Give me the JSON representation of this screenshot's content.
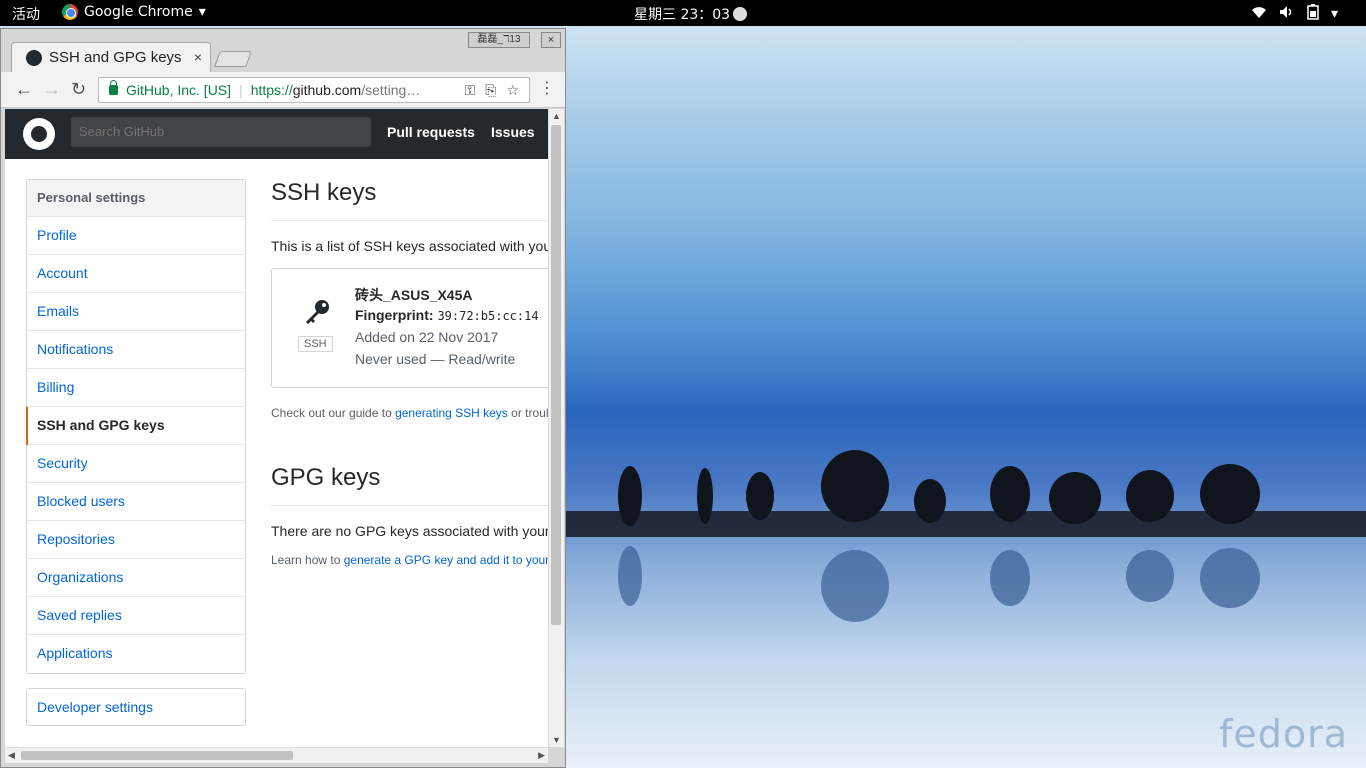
{
  "topbar": {
    "activities": "活动",
    "app_name": "Google Chrome",
    "app_menu_icon": "chevron-down-icon",
    "clock": "星期三 23：03"
  },
  "window": {
    "tab_title": "SSH and GPG keys",
    "tab_close": "×",
    "profile_badge": "磊磊_ℸ13",
    "close": "×"
  },
  "omnibox": {
    "ev_label": "GitHub, Inc. [US]",
    "url_scheme": "https://",
    "url_domain": "github.com",
    "url_path": "/setting…"
  },
  "github": {
    "search_placeholder": "Search GitHub",
    "nav": [
      "Pull requests",
      "Issues"
    ],
    "menu_heading": "Personal settings",
    "menu": [
      "Profile",
      "Account",
      "Emails",
      "Notifications",
      "Billing",
      "SSH and GPG keys",
      "Security",
      "Blocked users",
      "Repositories",
      "Organizations",
      "Saved replies",
      "Applications"
    ],
    "selected_menu": "SSH and GPG keys",
    "developer_settings": "Developer settings",
    "ssh_heading": "SSH keys",
    "ssh_description": "This is a list of SSH keys associated with you",
    "key": {
      "title": "砖头_ASUS_X45A",
      "fingerprint_label": "Fingerprint:",
      "fingerprint": "39:72:b5:cc:14",
      "added": "Added on 22 Nov 2017",
      "usage": "Never used — Read/write",
      "badge": "SSH"
    },
    "ssh_guide_prefix": "Check out our guide to ",
    "ssh_guide_link": "generating SSH keys",
    "ssh_guide_suffix": " or troul",
    "gpg_heading": "GPG keys",
    "gpg_description": "There are no GPG keys associated with your",
    "gpg_learn_prefix": "Learn how to ",
    "gpg_learn_link": "generate a GPG key and add it to your"
  },
  "desktop": {
    "logo_text": "fedora"
  },
  "colors": {
    "header": "#24292e",
    "link": "#0366d6",
    "selected_accent": "#e36209",
    "secure_green": "#0b8043"
  }
}
